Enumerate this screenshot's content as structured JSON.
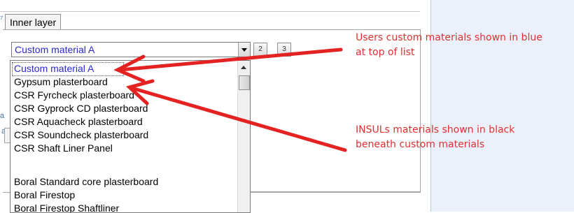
{
  "tab": {
    "label": "Inner layer"
  },
  "material_combo": {
    "selected": "Custom material A"
  },
  "side_buttons": [
    "2",
    "3"
  ],
  "dropdown": {
    "items": [
      {
        "label": "Custom material A",
        "type": "custom"
      },
      {
        "label": "Gypsum plasterboard",
        "type": "custom"
      },
      {
        "label": "CSR Fyrcheck plasterboard",
        "type": "insul"
      },
      {
        "label": "CSR Gyprock CD plasterboard",
        "type": "insul"
      },
      {
        "label": "CSR Aquacheck plasterboard",
        "type": "insul"
      },
      {
        "label": "CSR Soundcheck plasterboard",
        "type": "insul"
      },
      {
        "label": "CSR Shaft Liner Panel",
        "type": "insul"
      },
      {
        "label": "",
        "type": "spacer"
      },
      {
        "label": "Boral Standard core plasterboard",
        "type": "insul"
      },
      {
        "label": "Boral Firestop",
        "type": "insul"
      },
      {
        "label": "Boral Firestop Shaftliner",
        "type": "insul"
      }
    ]
  },
  "annotations": {
    "top": [
      "Users custom materials shown in blue",
      "at top of list"
    ],
    "bottom": [
      "INSULs materials shown in black",
      "beneath custom materials"
    ],
    "color": "#e03030"
  },
  "colors": {
    "custom_text": "#2a2ad0",
    "right_panel": "#eaf1fb"
  }
}
